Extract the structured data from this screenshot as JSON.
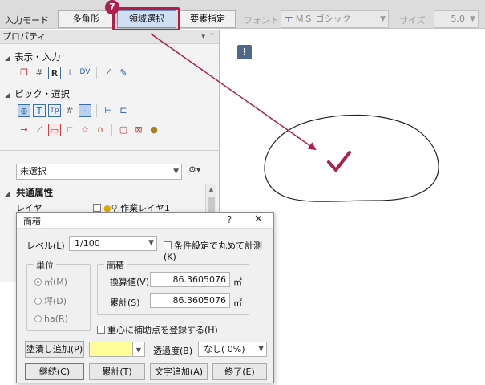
{
  "toolbar": {
    "input_mode_label": "入力モード",
    "polygon_button": "多角形",
    "area_select_button": "領域選択",
    "element_button": "要素指定",
    "font_label": "フォント",
    "font_value": "ＭＳ ゴシック",
    "size_label": "サイズ",
    "size_value": "5.0",
    "step_badge": "7"
  },
  "panel": {
    "title": "プロパティ",
    "section_display": "表示・入力",
    "section_pick": "ピック・選択",
    "selection_value": "未選択",
    "category": "共通属性",
    "layer_label": "レイヤ",
    "layer_value": "作業レイヤ1"
  },
  "icons": [
    "layer-icon",
    "grid-icon",
    "r-icon",
    "align-icon",
    "dv-icon",
    "magic-icon",
    "eyedropper-icon",
    "pick-center-icon",
    "pick-t-icon",
    "pick-tp-icon",
    "hash-p-icon",
    "pick-p-icon",
    "pick-line-icon",
    "pick-ep-icon",
    "segment-icon",
    "angle-icon",
    "rect-select-icon",
    "node-icon",
    "star-icon",
    "curve-icon",
    "frame-icon",
    "frame-x-icon",
    "bag-icon",
    "tool-icon"
  ],
  "dialog": {
    "title": "面積",
    "help": "?",
    "close": "✕",
    "level_label": "レベル(L)",
    "level_value": "1/100",
    "condition_checkbox": "条件設定で丸めて計測(K)",
    "unit_group": "単位",
    "unit_m2": "㎡(M)",
    "unit_tsubo": "坪(D)",
    "unit_ha": "ha(R)",
    "area_group": "面積",
    "converted_label": "換算値(V)",
    "converted_value": "86.3605076",
    "total_label": "累計(S)",
    "total_value": "86.3605076",
    "unit_suffix": "㎡",
    "centroid_checkbox": "重心に補助点を登録する(H)",
    "fill_button": "塗潰し追加(P)",
    "transparency_label": "透過度(B)",
    "transparency_value": "なし( 0%)",
    "continue_button": "継続(C)",
    "total_button": "累計(T)",
    "add_text_button": "文字追加(A)",
    "finish_button": "終了(E)"
  },
  "colors": {
    "accent": "#b01e4a",
    "fill_swatch": "#ffff99"
  }
}
